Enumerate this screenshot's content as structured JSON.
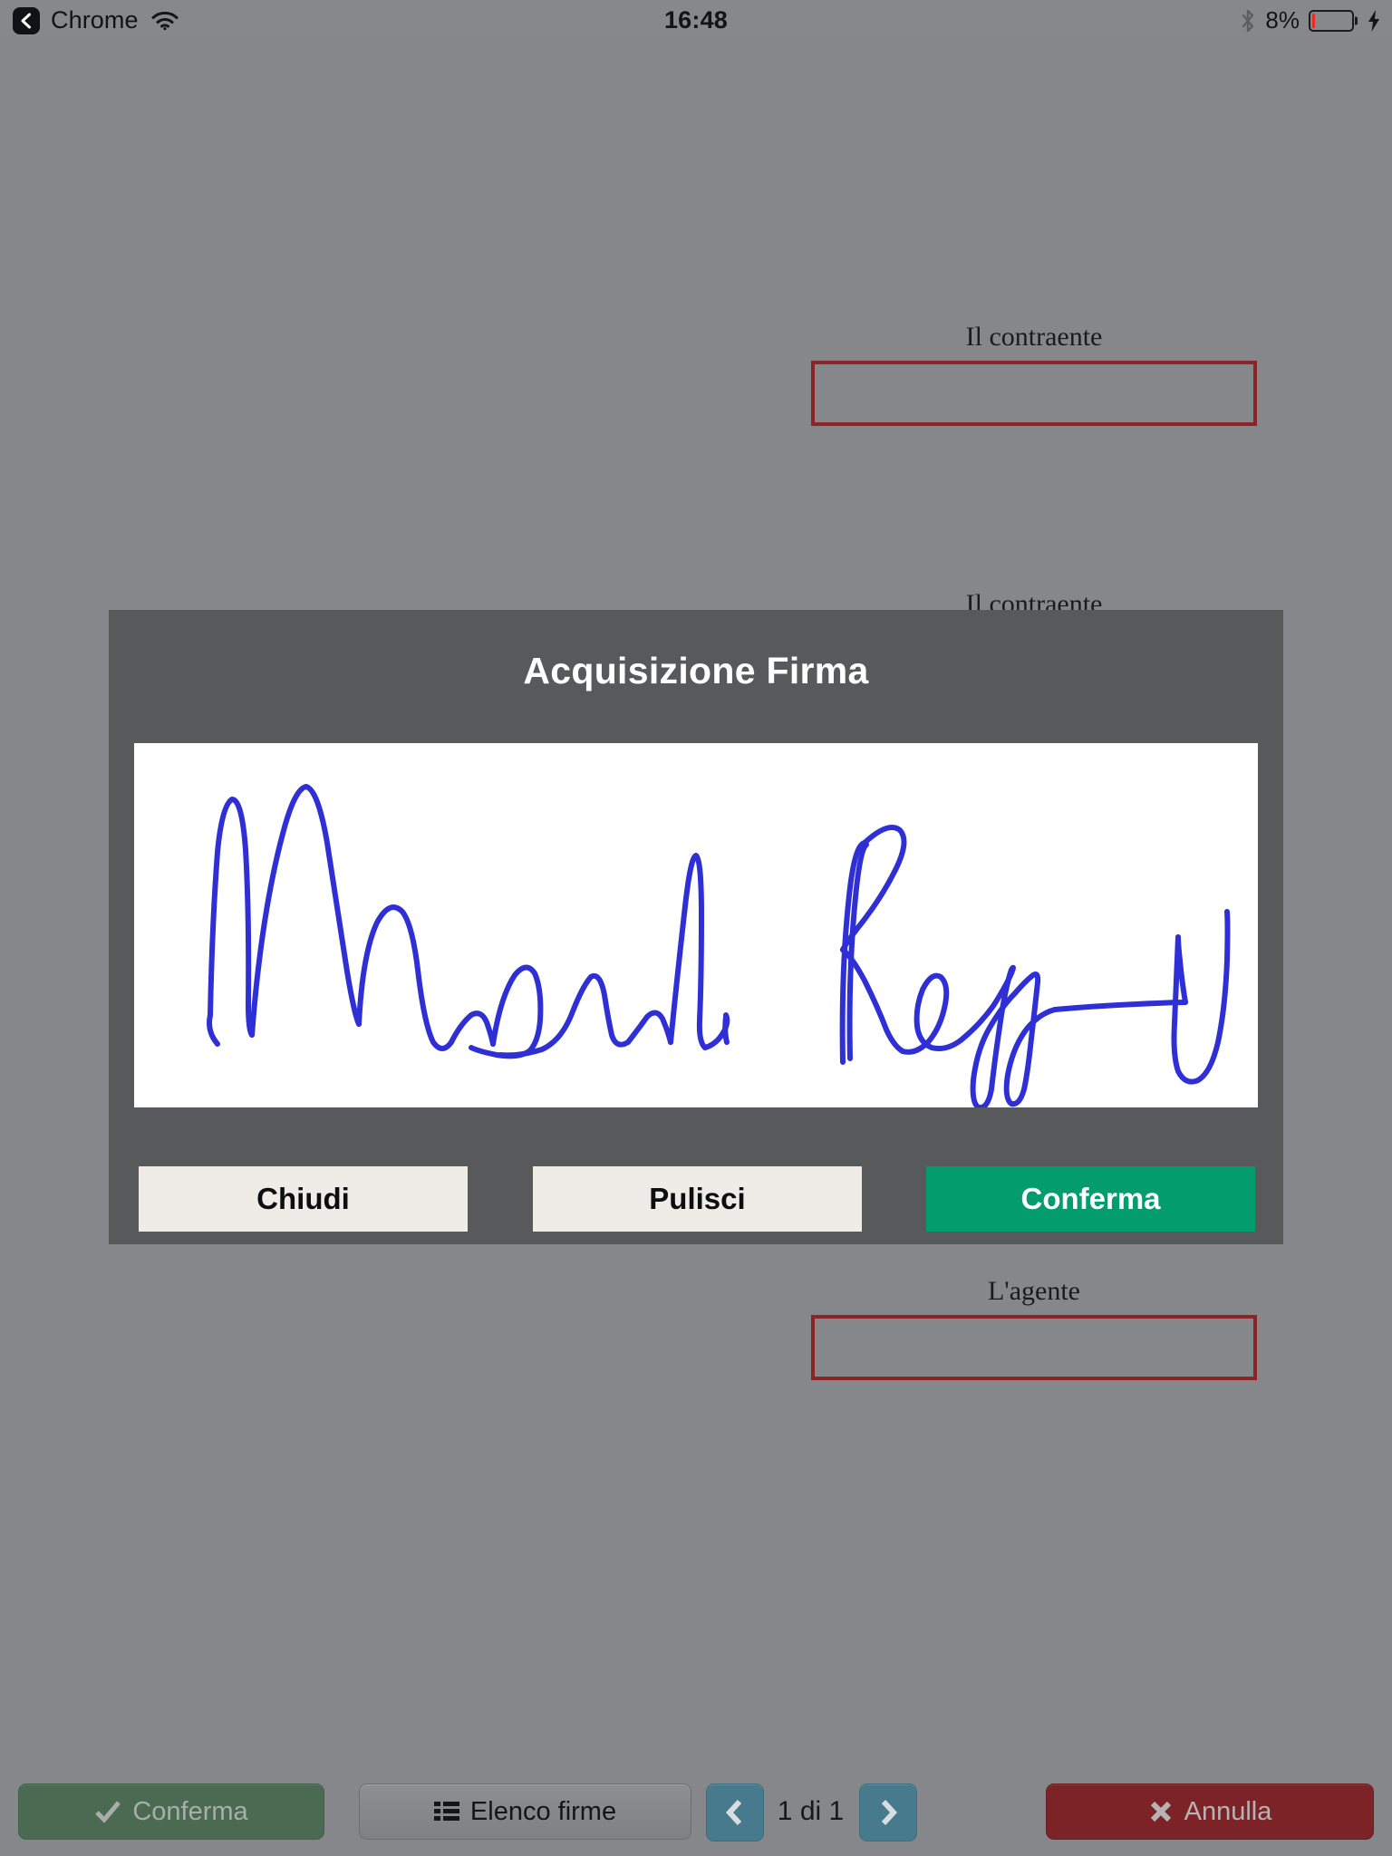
{
  "statusbar": {
    "back_label": "Chrome",
    "back_icon": "chevron-left-icon",
    "wifi_icon": "wifi-icon",
    "time": "16:48",
    "bluetooth_icon": "bluetooth-icon",
    "battery_percent": "8%",
    "battery_level": 8,
    "battery_color": "#ec2a21",
    "charging_icon": "lightning-bolt-icon"
  },
  "document": {
    "signature_blocks": [
      {
        "label": "Il contraente",
        "value": ""
      },
      {
        "label": "Il contraente",
        "value": ""
      },
      {
        "label": "L'agente",
        "value": ""
      }
    ],
    "box_border_color": "#8d2327",
    "background_color": "#85878b"
  },
  "dialog": {
    "title": "Acquisizione Firma",
    "background_color": "#58595b",
    "canvas": {
      "name": "signature-canvas",
      "background_color": "#ffffff",
      "ink_color": "#2f2fd6",
      "has_signature": true
    },
    "buttons": {
      "close": {
        "label": "Chiudi",
        "color": "#efece7"
      },
      "clear": {
        "label": "Pulisci",
        "color": "#efece7"
      },
      "confirm": {
        "label": "Conferma",
        "color": "#039c6d"
      }
    }
  },
  "toolbar": {
    "confirm": {
      "label": "Conferma",
      "icon": "check-icon",
      "color": "#4a6a52",
      "enabled": false
    },
    "signature_list": {
      "label": "Elenco firme",
      "icon": "list-icon"
    },
    "prev": {
      "icon": "chevron-left-icon"
    },
    "next": {
      "icon": "chevron-right-icon"
    },
    "page_indicator": "1 di 1",
    "cancel": {
      "label": "Annulla",
      "icon": "close-x-icon",
      "color": "#7b2326"
    }
  }
}
